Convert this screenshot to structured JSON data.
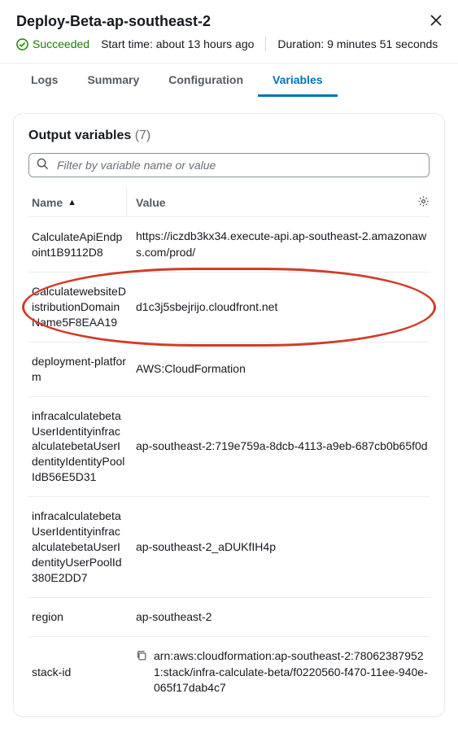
{
  "header": {
    "title": "Deploy-Beta-ap-southeast-2",
    "status": "Succeeded",
    "start_label": "Start time:",
    "start_value": "about 13 hours ago",
    "duration_label": "Duration:",
    "duration_value": "9 minutes 51 seconds"
  },
  "tabs": {
    "logs": "Logs",
    "summary": "Summary",
    "configuration": "Configuration",
    "variables": "Variables"
  },
  "card": {
    "title": "Output variables",
    "count": "(7)",
    "filter_placeholder": "Filter by variable name or value"
  },
  "table": {
    "col_name": "Name",
    "col_value": "Value",
    "rows": [
      {
        "name": "CalculateApiEndpoint1B9112D8",
        "value": "https://iczdb3kx34.execute-api.ap-southeast-2.amazonaws.com/prod/",
        "copy": false
      },
      {
        "name": "CalculatewebsiteDistributionDomainName5F8EAA19",
        "value": "d1c3j5sbejrijo.cloudfront.net",
        "copy": false,
        "highlight": true
      },
      {
        "name": "deployment-platform",
        "value": "AWS:CloudFormation",
        "copy": false
      },
      {
        "name": "infracalculatebetaUserIdentityinfracalculatebetaUserIdentityIdentityPoolIdB56E5D31",
        "value": "ap-southeast-2:719e759a-8dcb-4113-a9eb-687cb0b65f0d",
        "copy": false
      },
      {
        "name": "infracalculatebetaUserIdentityinfracalculatebetaUserIdentityUserPoolId380E2DD7",
        "value": "ap-southeast-2_aDUKfIH4p",
        "copy": false
      },
      {
        "name": "region",
        "value": "ap-southeast-2",
        "copy": false
      },
      {
        "name": "stack-id",
        "value": "arn:aws:cloudformation:ap-southeast-2:780623879521:stack/infra-calculate-beta/f0220560-f470-11ee-940e-065f17dab4c7",
        "copy": true
      }
    ]
  }
}
